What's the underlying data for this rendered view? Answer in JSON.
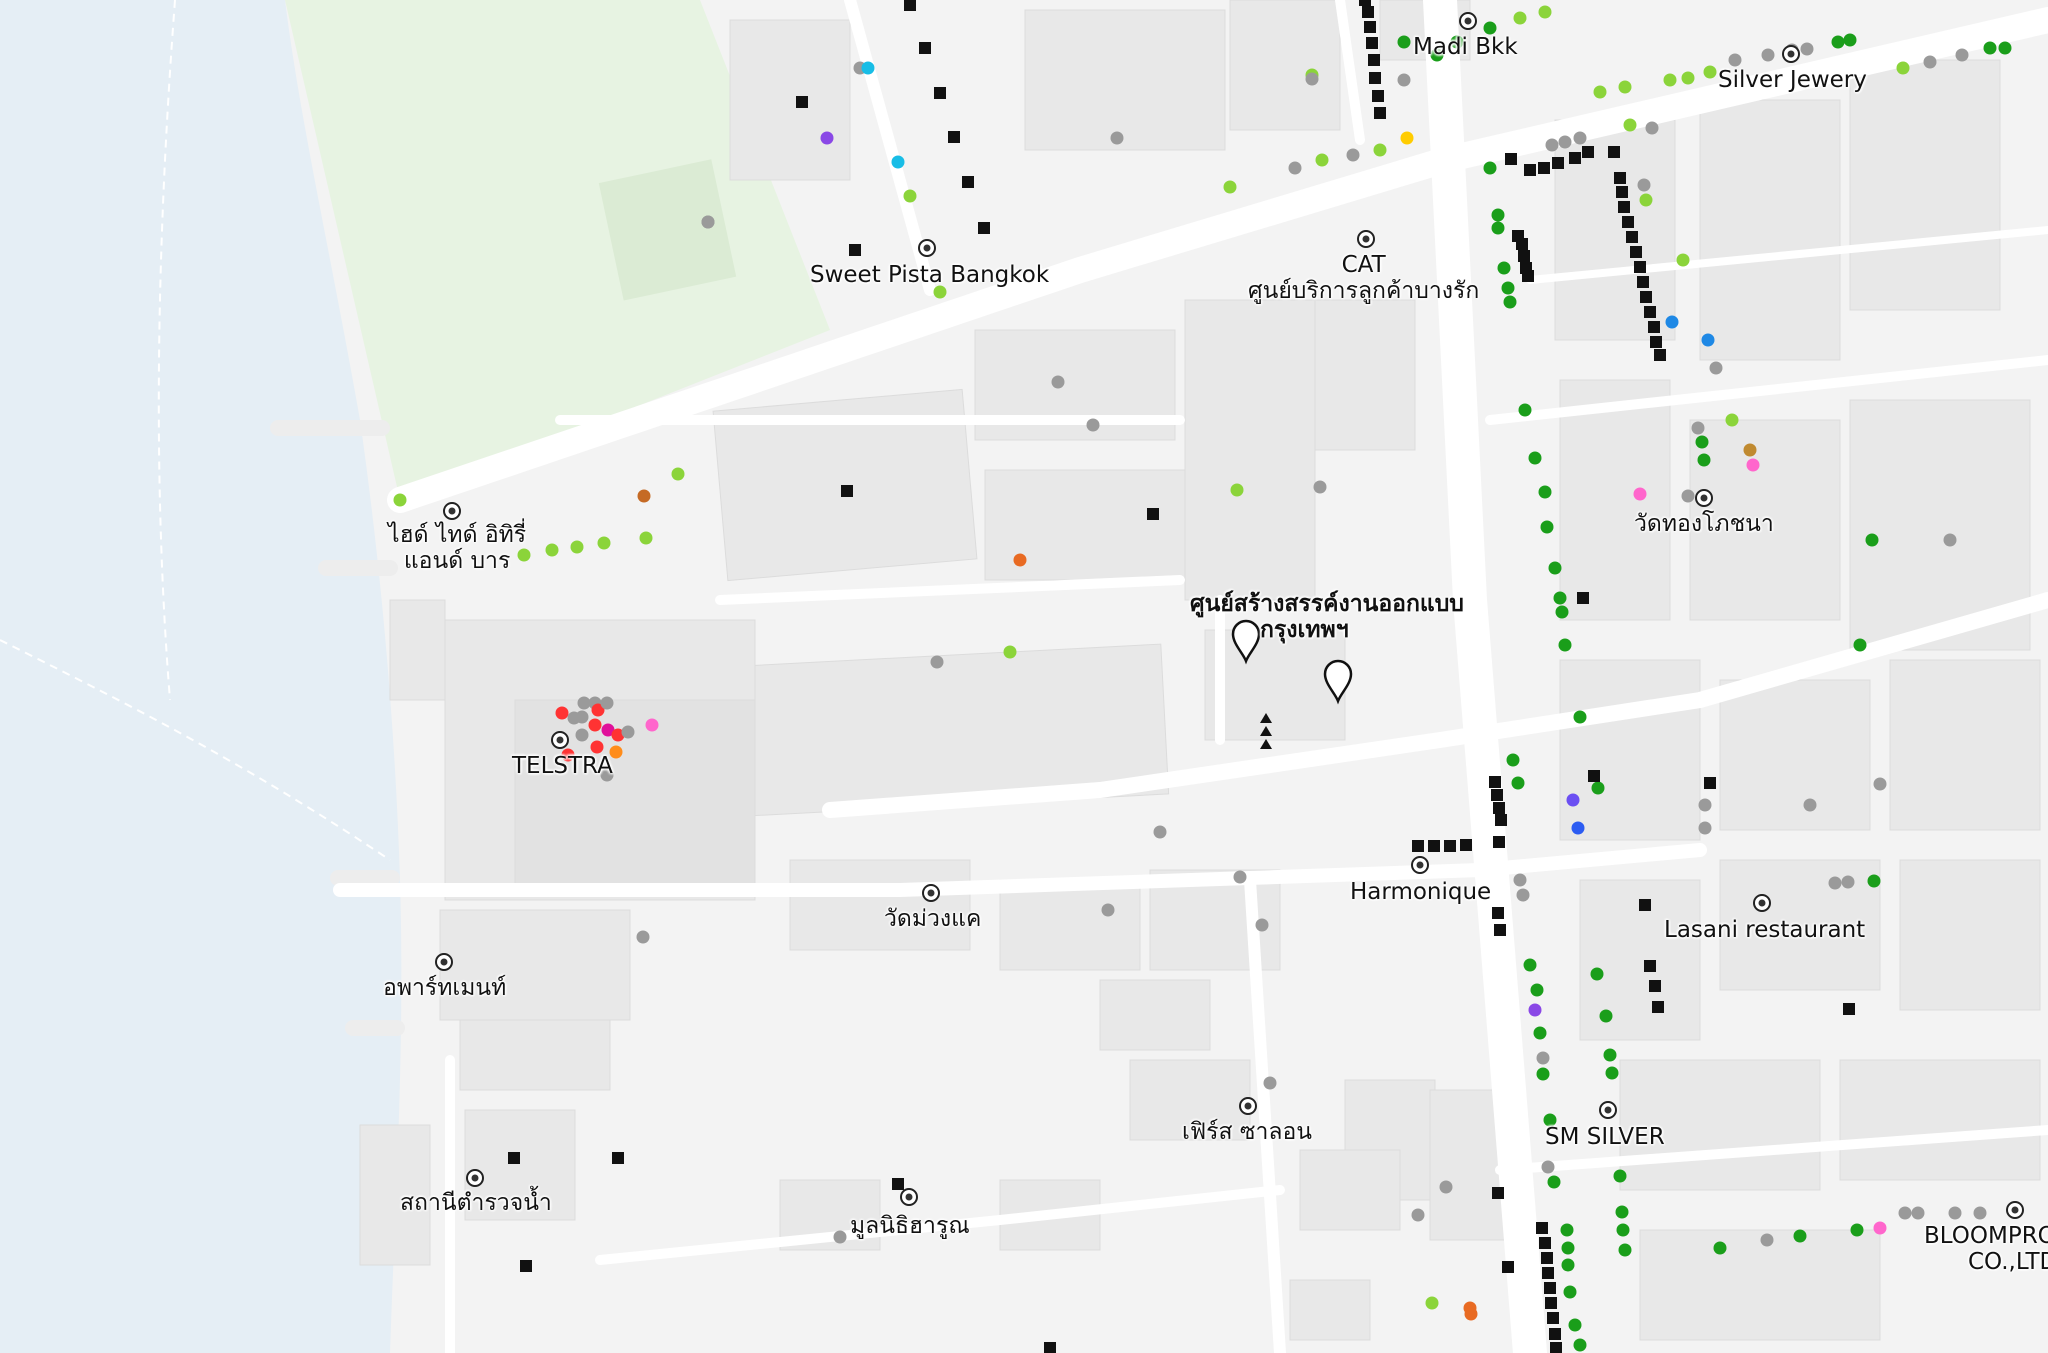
{
  "map": {
    "colors": {
      "water": "#e5eef5",
      "park": "#e7f3e2",
      "land": "#f3f3f3",
      "road": "#ffffff",
      "building": "#e7e7e7"
    },
    "labels": {
      "madi_bkk": "Madi Bkk",
      "silver_jewery": "Silver Jewery",
      "sweet_pista": "Sweet Pista Bangkok",
      "cat_line1": "CAT",
      "cat_line2": "ศูนย์บริการลูกค้าบางรัก",
      "hide_line1": "ไฮด์ ไทด์ อิทิรี่",
      "hide_line2": "แอนด์ บาร",
      "wat_thong": "วัดทองโภชนา",
      "tcdc_line1": "ศูนย์สร้างสรรค์งานออกแบบ",
      "tcdc_line2": "กรุงเทพฯ",
      "telstra": "TELSTRA",
      "harmonique": "Harmonique",
      "lasani": "Lasani restaurant",
      "wat_muang_khae": "วัดม่วงแค",
      "apartment": "อพาร์ทเมนท์",
      "first_salon": "เฟิร์ส ซาลอน",
      "sm_silver": "SM SILVER",
      "police": "สถานีตำรวจน้ำ",
      "foundation": "มูลนิธิฮารูณ",
      "bloompro_line1": "BLOOMPRO",
      "bloompro_line2": "CO.,LTD"
    }
  }
}
